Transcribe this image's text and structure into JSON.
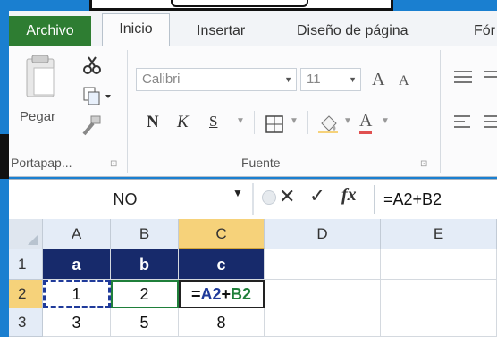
{
  "ribbon": {
    "tabs": [
      {
        "name": "archivo",
        "label": "Archivo"
      },
      {
        "name": "inicio",
        "label": "Inicio"
      },
      {
        "name": "insertar",
        "label": "Insertar"
      },
      {
        "name": "diseno",
        "label": "Diseño de página"
      },
      {
        "name": "formulas",
        "label": "Fór"
      }
    ],
    "clipboard": {
      "paste_label": "Pegar",
      "group_label": "Portapap...",
      "launcher": "⊡"
    },
    "font": {
      "font_name": "Calibri",
      "font_size": "11",
      "grow": "A",
      "shrink": "A",
      "bold": "N",
      "italic": "K",
      "underline": "S",
      "border_icon": "border-icon",
      "fill_icon": "fill-color-icon",
      "font_color": "A",
      "group_label": "Fuente",
      "launcher": "⊡"
    },
    "align": {
      "align_icon": "align-icon"
    }
  },
  "formula_bar": {
    "name_box": "NO",
    "cancel_glyph": "✕",
    "enter_glyph": "✓",
    "fx_label": "fx",
    "formula": "=A2+B2"
  },
  "grid": {
    "columns": [
      "A",
      "B",
      "C",
      "D",
      "E"
    ],
    "rows": [
      "1",
      "2",
      "3"
    ],
    "row1": [
      "a",
      "b",
      "c"
    ],
    "row2": [
      "1",
      "2",
      "=A2+B2"
    ],
    "row3": [
      "3",
      "5",
      "8"
    ],
    "row2_formula_parts": {
      "eq": "=",
      "ref1": "A2",
      "op": "+",
      "ref2": "B2"
    }
  },
  "colors": {
    "header_dark": "#172a6b",
    "archivo_tab": "#2e7d32",
    "active_header": "#f6d27a",
    "ref_a2": "#1f3a9a",
    "ref_b2": "#1f7f3a"
  }
}
